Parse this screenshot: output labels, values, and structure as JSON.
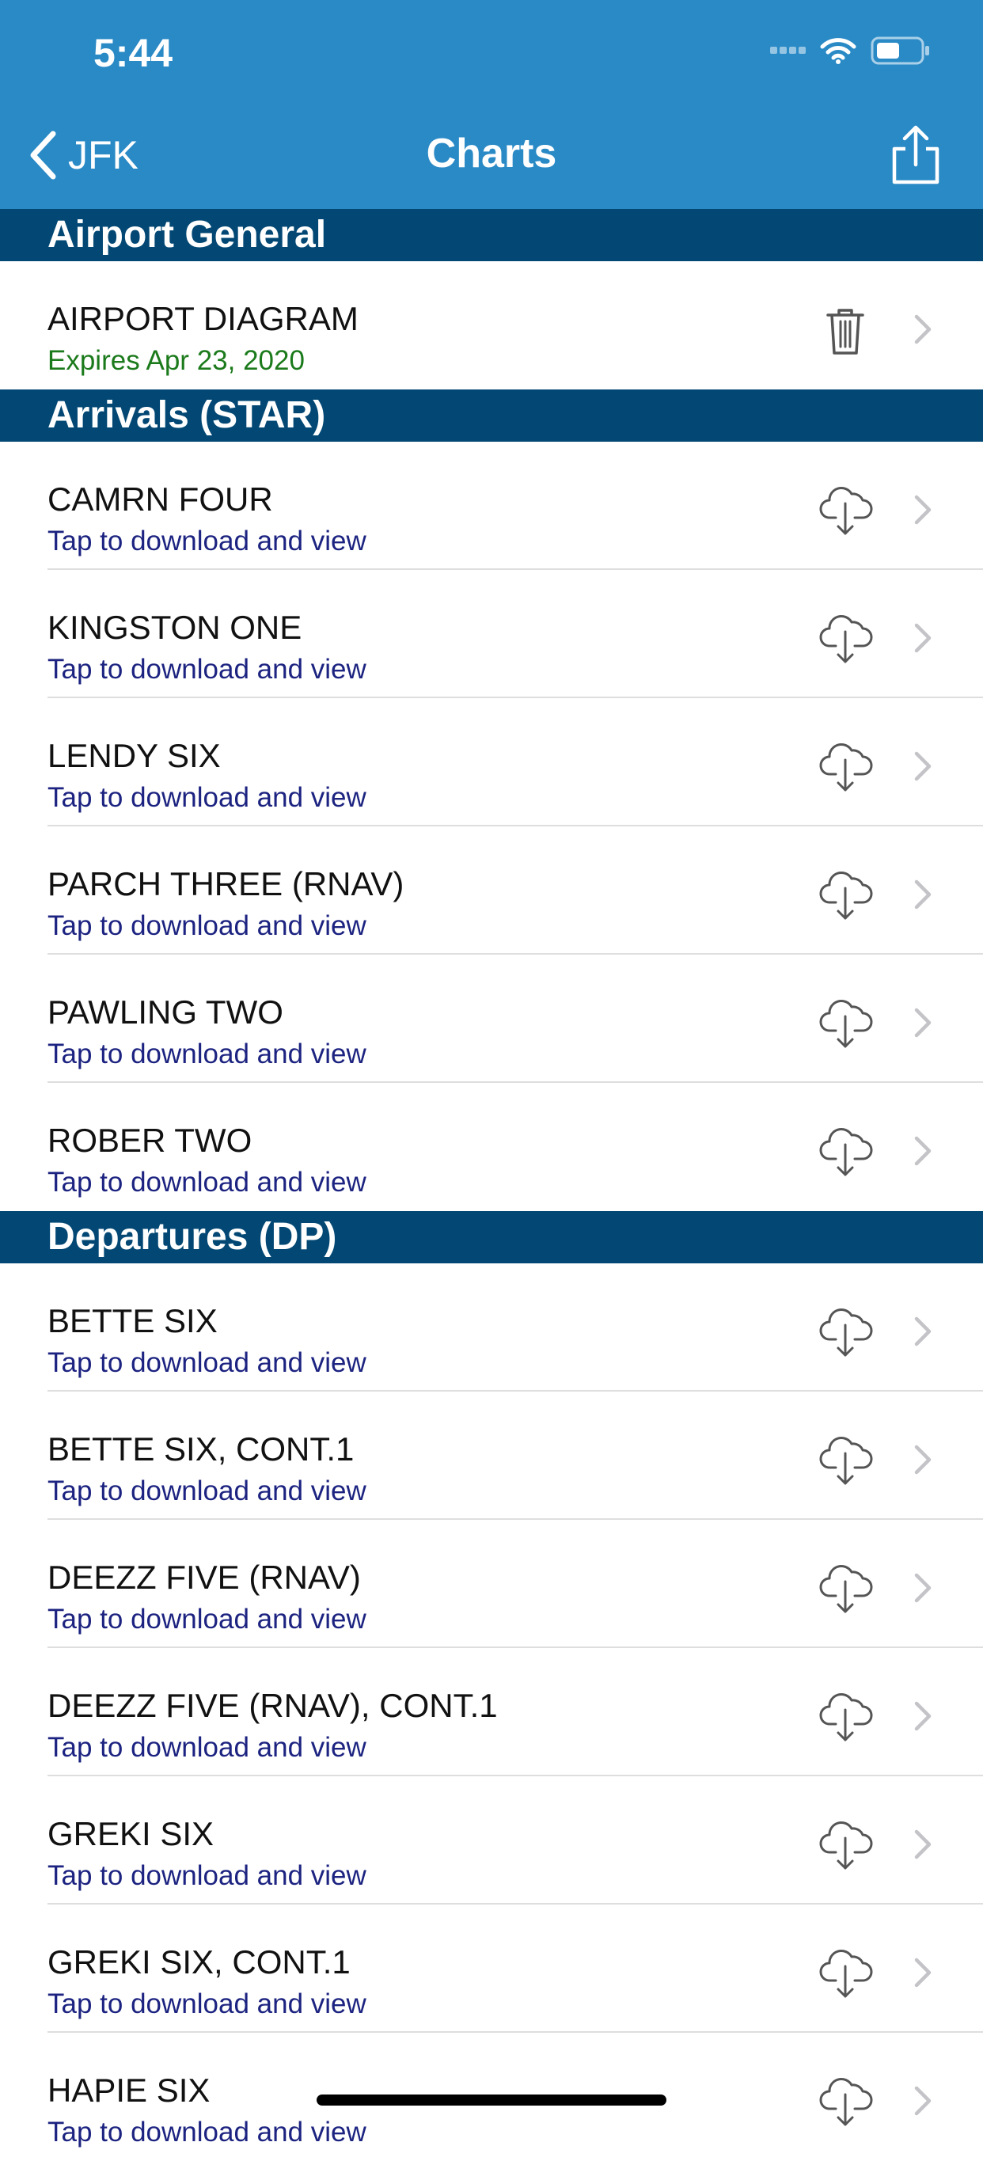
{
  "status_bar": {
    "time": "5:44"
  },
  "nav": {
    "back_label": "JFK",
    "title": "Charts"
  },
  "colors": {
    "nav_bg": "#2a8ac6",
    "section_bg": "#034874",
    "subtitle_link": "#1c2380",
    "expires_green": "#1b7a1b"
  },
  "sections": [
    {
      "title": "Airport General",
      "items": [
        {
          "title": "AIRPORT DIAGRAM",
          "subtitle": "Expires Apr 23, 2020",
          "status": "downloaded",
          "action_icon": "trash-icon"
        }
      ]
    },
    {
      "title": "Arrivals (STAR)",
      "items": [
        {
          "title": "CAMRN FOUR",
          "subtitle": "Tap to download and view",
          "status": "not_downloaded",
          "action_icon": "cloud-download-icon"
        },
        {
          "title": "KINGSTON ONE",
          "subtitle": "Tap to download and view",
          "status": "not_downloaded",
          "action_icon": "cloud-download-icon"
        },
        {
          "title": "LENDY SIX",
          "subtitle": "Tap to download and view",
          "status": "not_downloaded",
          "action_icon": "cloud-download-icon"
        },
        {
          "title": "PARCH THREE (RNAV)",
          "subtitle": "Tap to download and view",
          "status": "not_downloaded",
          "action_icon": "cloud-download-icon"
        },
        {
          "title": "PAWLING TWO",
          "subtitle": "Tap to download and view",
          "status": "not_downloaded",
          "action_icon": "cloud-download-icon"
        },
        {
          "title": "ROBER TWO",
          "subtitle": "Tap to download and view",
          "status": "not_downloaded",
          "action_icon": "cloud-download-icon"
        }
      ]
    },
    {
      "title": "Departures (DP)",
      "items": [
        {
          "title": "BETTE SIX",
          "subtitle": "Tap to download and view",
          "status": "not_downloaded",
          "action_icon": "cloud-download-icon"
        },
        {
          "title": "BETTE SIX, CONT.1",
          "subtitle": "Tap to download and view",
          "status": "not_downloaded",
          "action_icon": "cloud-download-icon"
        },
        {
          "title": "DEEZZ FIVE (RNAV)",
          "subtitle": "Tap to download and view",
          "status": "not_downloaded",
          "action_icon": "cloud-download-icon"
        },
        {
          "title": "DEEZZ FIVE (RNAV), CONT.1",
          "subtitle": "Tap to download and view",
          "status": "not_downloaded",
          "action_icon": "cloud-download-icon"
        },
        {
          "title": "GREKI SIX",
          "subtitle": "Tap to download and view",
          "status": "not_downloaded",
          "action_icon": "cloud-download-icon"
        },
        {
          "title": "GREKI SIX, CONT.1",
          "subtitle": "Tap to download and view",
          "status": "not_downloaded",
          "action_icon": "cloud-download-icon"
        },
        {
          "title": "HAPIE SIX",
          "subtitle": "Tap to download and view",
          "status": "not_downloaded",
          "action_icon": "cloud-download-icon"
        }
      ]
    }
  ]
}
